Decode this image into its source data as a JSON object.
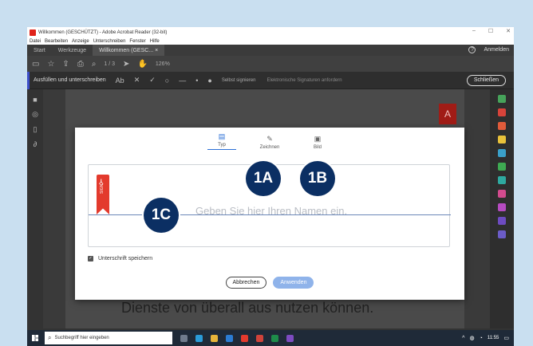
{
  "window": {
    "title": "Willkommen (GESCHÜTZT) - Adobe Acrobat Reader (32-bit)",
    "controls": [
      "–",
      "☐",
      "✕"
    ]
  },
  "menubar": [
    "Datei",
    "Bearbeiten",
    "Anzeige",
    "Unterschreiben",
    "Fenster",
    "Hilfe"
  ],
  "tabs": {
    "items": [
      "Start",
      "Werkzeuge",
      "Willkommen (GESC... ×"
    ],
    "help": "?",
    "signin": "Anmelden"
  },
  "toolbar": {
    "page": "1 / 3",
    "zoom": "126%"
  },
  "fill_sign": {
    "label": "Ausfüllen und unterschreiben",
    "self_sign": "Selbst signieren",
    "initials": "Elektronische Signaturen anfordern",
    "close": "Schließen"
  },
  "document": {
    "text": "Dienste von überall aus nutzen können."
  },
  "dialog": {
    "tabs": [
      {
        "label": "Typ",
        "icon": "keyboard-icon"
      },
      {
        "label": "Zeichnen",
        "icon": "pen-icon"
      },
      {
        "label": "Bild",
        "icon": "image-icon"
      }
    ],
    "bookmark_text": "SIGN",
    "placeholder": "Geben Sie hier Ihren Namen ein.",
    "save_signature": "Unterschrift speichern",
    "cancel": "Abbrechen",
    "apply": "Anwenden"
  },
  "callouts": [
    "1A",
    "1B",
    "1C"
  ],
  "taskbar": {
    "search": "Suchbegriff hier eingeben",
    "time": "11:55"
  },
  "colors": {
    "accent_blue": "#2b6fd6",
    "callout_navy": "#0b2f63",
    "adobe_red": "#e33a2d"
  }
}
